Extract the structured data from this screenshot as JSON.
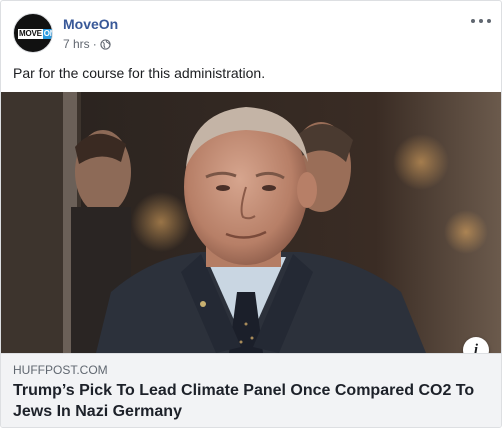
{
  "post": {
    "page_name": "MoveOn",
    "avatar_logo": {
      "part1": "MOVE",
      "part2": "ON"
    },
    "timestamp": "7 hrs",
    "separator": "·",
    "audience_icon": "globe-icon",
    "more_icon": "ellipsis-icon",
    "caption": "Par for the course for this administration.",
    "link": {
      "domain": "HUFFPOST.COM",
      "headline": "Trump’s Pick To Lead Climate Panel Once Compared CO2 To Jews In Nazi Germany",
      "info_icon": "i"
    }
  },
  "colors": {
    "page_name": "#385898",
    "meta_text": "#616770",
    "link_bg": "#f2f3f5",
    "logo_blue": "#2c9be0"
  }
}
